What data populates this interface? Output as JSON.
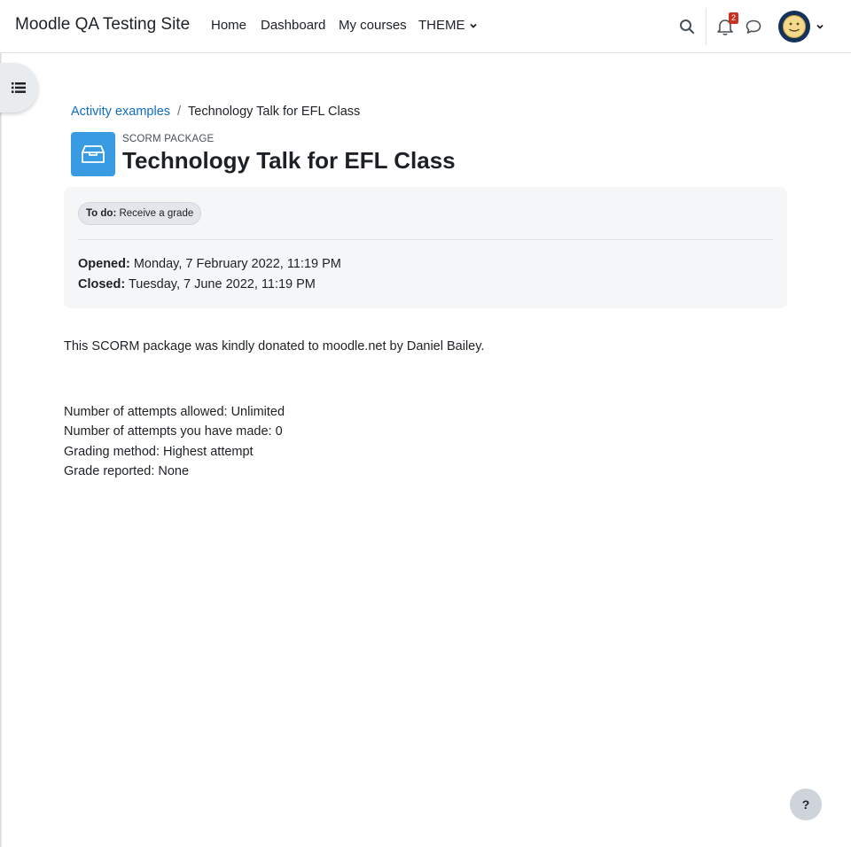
{
  "navbar": {
    "site_name": "Moodle QA Testing Site",
    "links": [
      "Home",
      "Dashboard",
      "My courses"
    ],
    "theme_menu": "THEME",
    "notification_count": "2",
    "icons": [
      "search-icon",
      "bell-icon",
      "chat-bubble-icon",
      "chevron-down-icon"
    ]
  },
  "drawer": {
    "icon": "list-icon"
  },
  "breadcrumb": {
    "parent": "Activity examples",
    "separator": "/",
    "current": "Technology Talk for EFL Class"
  },
  "header": {
    "activity_type": "SCORM PACKAGE",
    "title": "Technology Talk for EFL Class",
    "accent": "#399be2"
  },
  "dates": {
    "todo_label": "To do:",
    "todo_value": "Receive a grade",
    "opened_label": "Opened:",
    "opened_value": "Monday, 7 February 2022, 11:19 PM",
    "closed_label": "Closed:",
    "closed_value": "Tuesday, 7 June 2022, 11:19 PM"
  },
  "intro": "This SCORM package was kindly donated to moodle.net by Daniel Bailey.",
  "info": [
    "Number of attempts allowed: Unlimited",
    "Number of attempts you have made: 0",
    "Grading method: Highest attempt",
    "Grade reported: None"
  ],
  "help": {
    "label": "?"
  },
  "colors": {
    "link": "#0f6cbf",
    "badge": "#ca3120"
  }
}
